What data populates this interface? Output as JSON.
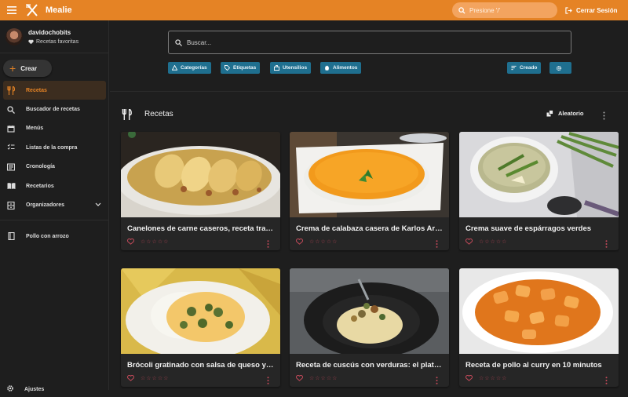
{
  "appbar": {
    "title": "Mealie",
    "search_placeholder": "Presione '/'",
    "logout_label": "Cerrar Sesión",
    "accent_color": "#e58325"
  },
  "sidebar": {
    "user_name": "davidochobits",
    "favorites_label": "Recetas favoritas",
    "create_label": "Crear",
    "items": [
      {
        "label": "Recetas",
        "icon": "fork-knife-icon",
        "active": true
      },
      {
        "label": "Buscador de recetas",
        "icon": "search-icon"
      },
      {
        "label": "Menús",
        "icon": "calendar-icon"
      },
      {
        "label": "Listas de la compra",
        "icon": "checklist-icon"
      },
      {
        "label": "Cronología",
        "icon": "timeline-icon"
      },
      {
        "label": "Recetarios",
        "icon": "book-open-icon"
      },
      {
        "label": "Organizadores",
        "icon": "organizer-icon"
      }
    ],
    "extra_item": {
      "label": "Pollo con arrozo",
      "icon": "book-icon"
    },
    "help_label": "Ajustes"
  },
  "search": {
    "placeholder": "Buscar...",
    "chips": [
      {
        "label": "Categorías",
        "icon": "category-icon"
      },
      {
        "label": "Etiquetas",
        "icon": "tag-icon"
      },
      {
        "label": "Utensilios",
        "icon": "tools-icon"
      },
      {
        "label": "Alimentos",
        "icon": "food-icon"
      }
    ],
    "sort_label": "Creado",
    "chip_color": "#1f6f8f"
  },
  "recipes": {
    "section_title": "Recetas",
    "random_label": "Aleatorio",
    "cards": [
      {
        "title": "Canelones de carne caseros, receta tradicional"
      },
      {
        "title": "Crema de calabaza casera de Karlos Arguiñano"
      },
      {
        "title": "Crema suave de espárragos verdes"
      },
      {
        "title": "Brócoli gratinado con salsa de queso y arroz"
      },
      {
        "title": "Receta de cuscús con verduras: el plato más fácil"
      },
      {
        "title": "Receta de pollo al curry en 10 minutos"
      }
    ],
    "stars": "☆☆☆☆☆"
  }
}
